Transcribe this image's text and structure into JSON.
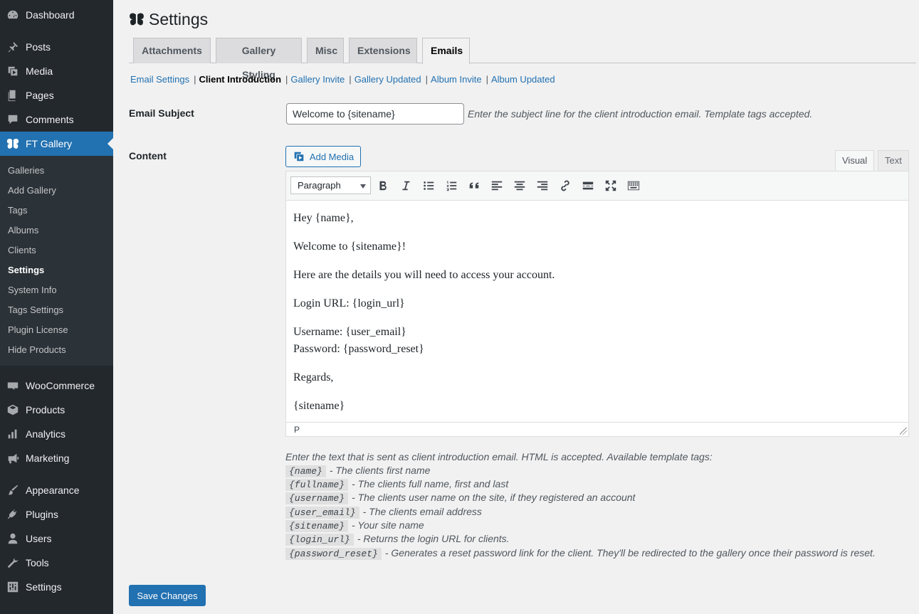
{
  "sidebar": {
    "menu": [
      {
        "label": "Dashboard",
        "icon": "dashboard-icon"
      },
      {
        "label": "Posts",
        "icon": "pin-icon"
      },
      {
        "label": "Media",
        "icon": "media-icon"
      },
      {
        "label": "Pages",
        "icon": "pages-icon"
      },
      {
        "label": "Comments",
        "icon": "comments-icon"
      },
      {
        "label": "FT Gallery",
        "icon": "butterfly-icon",
        "current": true
      },
      {
        "label": "WooCommerce",
        "icon": "woo-icon"
      },
      {
        "label": "Products",
        "icon": "box-icon"
      },
      {
        "label": "Analytics",
        "icon": "chart-icon"
      },
      {
        "label": "Marketing",
        "icon": "megaphone-icon"
      },
      {
        "label": "Appearance",
        "icon": "brush-icon"
      },
      {
        "label": "Plugins",
        "icon": "plug-icon"
      },
      {
        "label": "Users",
        "icon": "user-icon"
      },
      {
        "label": "Tools",
        "icon": "wrench-icon"
      },
      {
        "label": "Settings",
        "icon": "settings-icon"
      }
    ],
    "submenu": [
      {
        "label": "Galleries"
      },
      {
        "label": "Add Gallery"
      },
      {
        "label": "Tags"
      },
      {
        "label": "Albums"
      },
      {
        "label": "Clients"
      },
      {
        "label": "Settings",
        "current": true
      },
      {
        "label": "System Info"
      },
      {
        "label": "Tags Settings"
      },
      {
        "label": "Plugin License"
      },
      {
        "label": "Hide Products"
      }
    ]
  },
  "page": {
    "title": "Settings",
    "tabs": [
      {
        "label": "Attachments"
      },
      {
        "label": "Gallery Styling"
      },
      {
        "label": "Misc"
      },
      {
        "label": "Extensions"
      },
      {
        "label": "Emails",
        "active": true
      }
    ],
    "subnav": [
      {
        "label": "Email Settings"
      },
      {
        "label": "Client Introduction",
        "current": true
      },
      {
        "label": "Gallery Invite"
      },
      {
        "label": "Gallery Updated"
      },
      {
        "label": "Album Invite"
      },
      {
        "label": "Album Updated"
      }
    ],
    "subnav_separator": "|"
  },
  "form": {
    "subject_label": "Email Subject",
    "subject_value": "Welcome to {sitename}",
    "subject_desc": "Enter the subject line for the client introduction email. Template tags accepted.",
    "content_label": "Content",
    "add_media_label": "Add Media",
    "mode_visual": "Visual",
    "mode_text": "Text",
    "format_value": "Paragraph",
    "editor_lines": [
      "Hey {name},",
      "Welcome to {sitename}!",
      "Here are the details you will need to access your account.",
      "Login URL: {login_url}",
      "Username: {user_email}",
      "Password: {password_reset}",
      "Regards,",
      "{sitename}"
    ],
    "status_path": "P",
    "content_desc": "Enter the text that is sent as client introduction email. HTML is accepted. Available template tags:",
    "template_tags": [
      {
        "tag": "{name}",
        "desc": "- The clients first name"
      },
      {
        "tag": "{fullname}",
        "desc": "- The clients full name, first and last"
      },
      {
        "tag": "{username}",
        "desc": "- The clients user name on the site, if they registered an account"
      },
      {
        "tag": "{user_email}",
        "desc": "- The clients email address"
      },
      {
        "tag": "{sitename}",
        "desc": "- Your site name"
      },
      {
        "tag": "{login_url}",
        "desc": "- Returns the login URL for clients."
      },
      {
        "tag": "{password_reset}",
        "desc": "- Generates a reset password link for the client. They'll be redirected to the gallery once their password is reset."
      }
    ],
    "save_label": "Save Changes"
  },
  "colors": {
    "sidebar_bg": "#23282d",
    "submenu_bg": "#2c3338",
    "accent": "#2271b1",
    "page_bg": "#f1f1f1"
  }
}
